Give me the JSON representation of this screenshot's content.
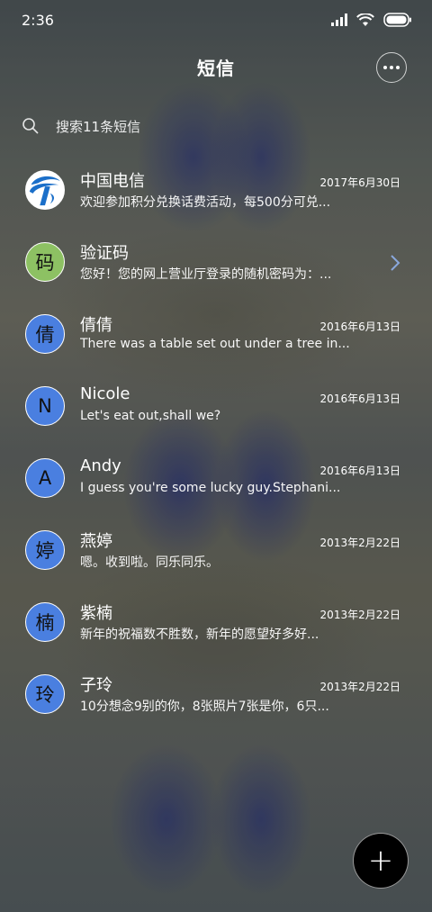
{
  "status_bar": {
    "time": "2:36",
    "icons": [
      "signal-icon",
      "wifi-icon",
      "battery-icon"
    ]
  },
  "header": {
    "title": "短信",
    "more_icon": "more-dots-icon"
  },
  "search": {
    "placeholder": "搜索11条短信",
    "icon": "search-icon"
  },
  "colors": {
    "avatar_green": "#8dc163",
    "avatar_blue": "#4a7fe0",
    "chevron": "#8aa8dc",
    "fab": "#000000"
  },
  "conversations": [
    {
      "avatar": "",
      "avatar_type": "china-telecom-logo",
      "name": "中国电信",
      "date": "2017年6月30日",
      "preview": "欢迎参加积分兑换话费活动，每500分可兑..."
    },
    {
      "avatar": "码",
      "avatar_type": "green",
      "name": "验证码",
      "date": "",
      "preview": "您好！您的网上营业厅登录的随机密码为：..."
    },
    {
      "avatar": "倩",
      "avatar_type": "blue",
      "name": "倩倩",
      "date": "2016年6月13日",
      "preview": "There was a table set out under a tree in..."
    },
    {
      "avatar": "N",
      "avatar_type": "blue",
      "name": "Nicole",
      "date": "2016年6月13日",
      "preview": "Let's eat out,shall we?"
    },
    {
      "avatar": "A",
      "avatar_type": "blue",
      "name": "Andy",
      "date": "2016年6月13日",
      "preview": "I guess you're some lucky guy.Stephani..."
    },
    {
      "avatar": "婷",
      "avatar_type": "blue",
      "name": "燕婷",
      "date": "2013年2月22日",
      "preview": "嗯。收到啦。同乐同乐。"
    },
    {
      "avatar": "楠",
      "avatar_type": "blue",
      "name": "紫楠",
      "date": "2013年2月22日",
      "preview": "新年的祝福数不胜数，新年的愿望好多好..."
    },
    {
      "avatar": "玲",
      "avatar_type": "blue",
      "name": "子玲",
      "date": "2013年2月22日",
      "preview": "10分想念9别的你，8张照片7张是你，6只..."
    }
  ],
  "fab": {
    "label": "+",
    "icon": "plus-icon"
  }
}
